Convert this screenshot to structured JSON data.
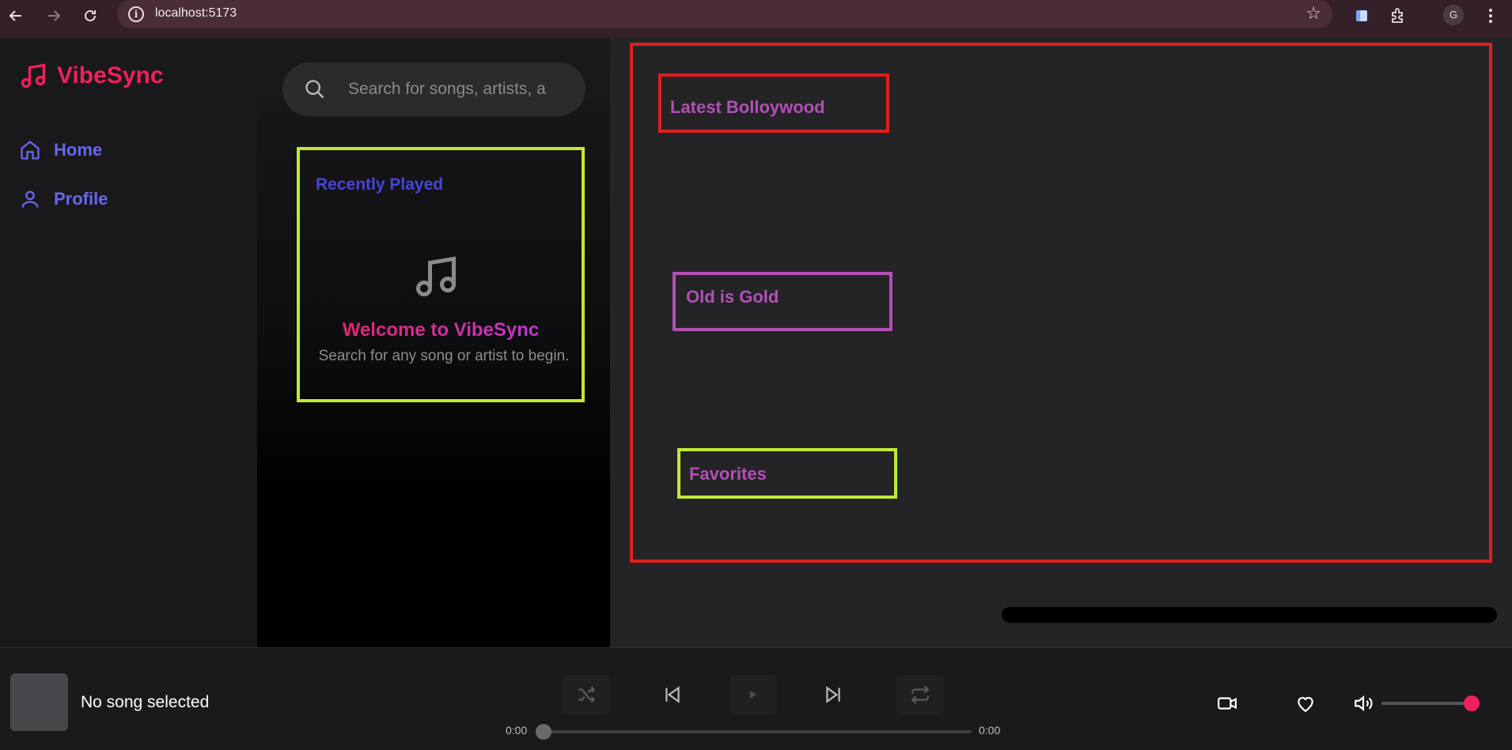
{
  "browser": {
    "url": "localhost:5173",
    "profile_initial": "G"
  },
  "app": {
    "name": "VibeSync",
    "nav": [
      {
        "label": "Home",
        "icon": "home-icon"
      },
      {
        "label": "Profile",
        "icon": "user-icon"
      }
    ]
  },
  "search": {
    "placeholder": "Search for songs, artists, a"
  },
  "recently_played": {
    "title": "Recently Played",
    "welcome_title": "Welcome to VibeSync",
    "welcome_subtitle": "Search for any song or artist to begin."
  },
  "sections": [
    {
      "label": "Latest Bolloywood"
    },
    {
      "label": "Old is Gold"
    },
    {
      "label": "Favorites"
    }
  ],
  "player": {
    "now_playing": "No song selected",
    "elapsed": "0:00",
    "duration": "0:00",
    "progress": 0,
    "volume": 1
  },
  "colors": {
    "accent": "#f0205a",
    "nav": "#6766f0",
    "section_text": "#b24fb6",
    "highlight_red": "#e01e1e",
    "highlight_green": "#c1e934"
  }
}
